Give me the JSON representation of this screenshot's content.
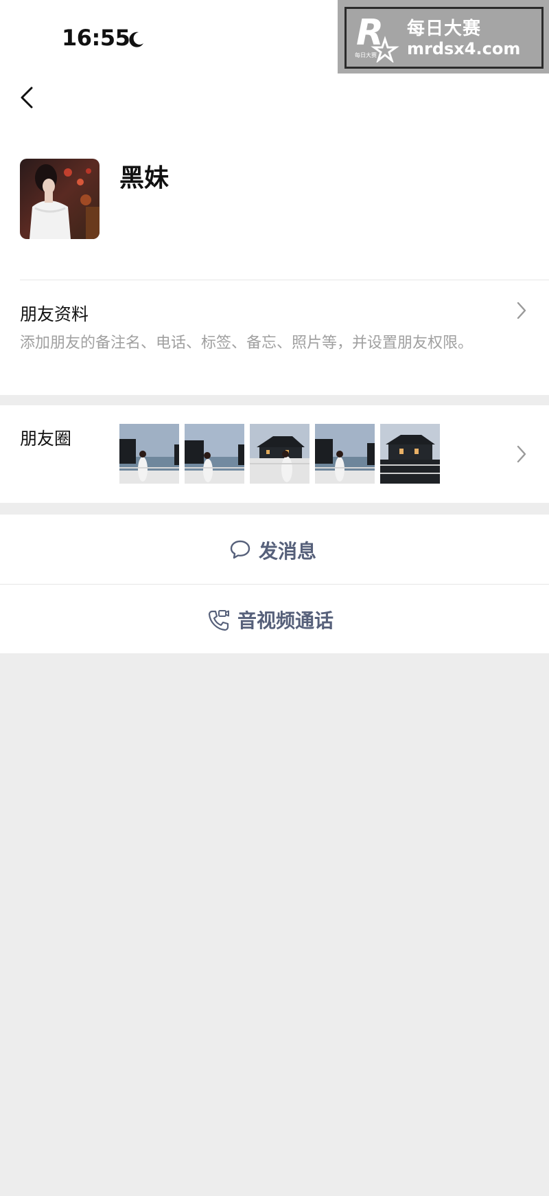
{
  "status_bar": {
    "time": "16:55"
  },
  "watermark": {
    "title": "每日大赛",
    "url": "mrdsx4.com",
    "logo_letter": "R",
    "logo_small": "每日大赛"
  },
  "profile": {
    "name": "黑妹"
  },
  "friend_info": {
    "title": "朋友资料",
    "description": "添加朋友的备注名、电话、标签、备忘、照片等，并设置朋友权限。"
  },
  "moments": {
    "title": "朋友圈",
    "photos": [
      "photo-1",
      "photo-2",
      "photo-3",
      "photo-4",
      "photo-5"
    ]
  },
  "actions": {
    "message_label": "发消息",
    "call_label": "音视频通话"
  },
  "colors": {
    "page_background": "#ededed",
    "card_background": "#ffffff",
    "action_text": "#56607a",
    "secondary_text": "#a0a0a0"
  },
  "icons": {
    "status": "moon-icon",
    "back": "back-arrow-icon",
    "chevron": "chevron-right-icon",
    "message": "chat-bubble-icon",
    "call": "phone-video-icon"
  }
}
